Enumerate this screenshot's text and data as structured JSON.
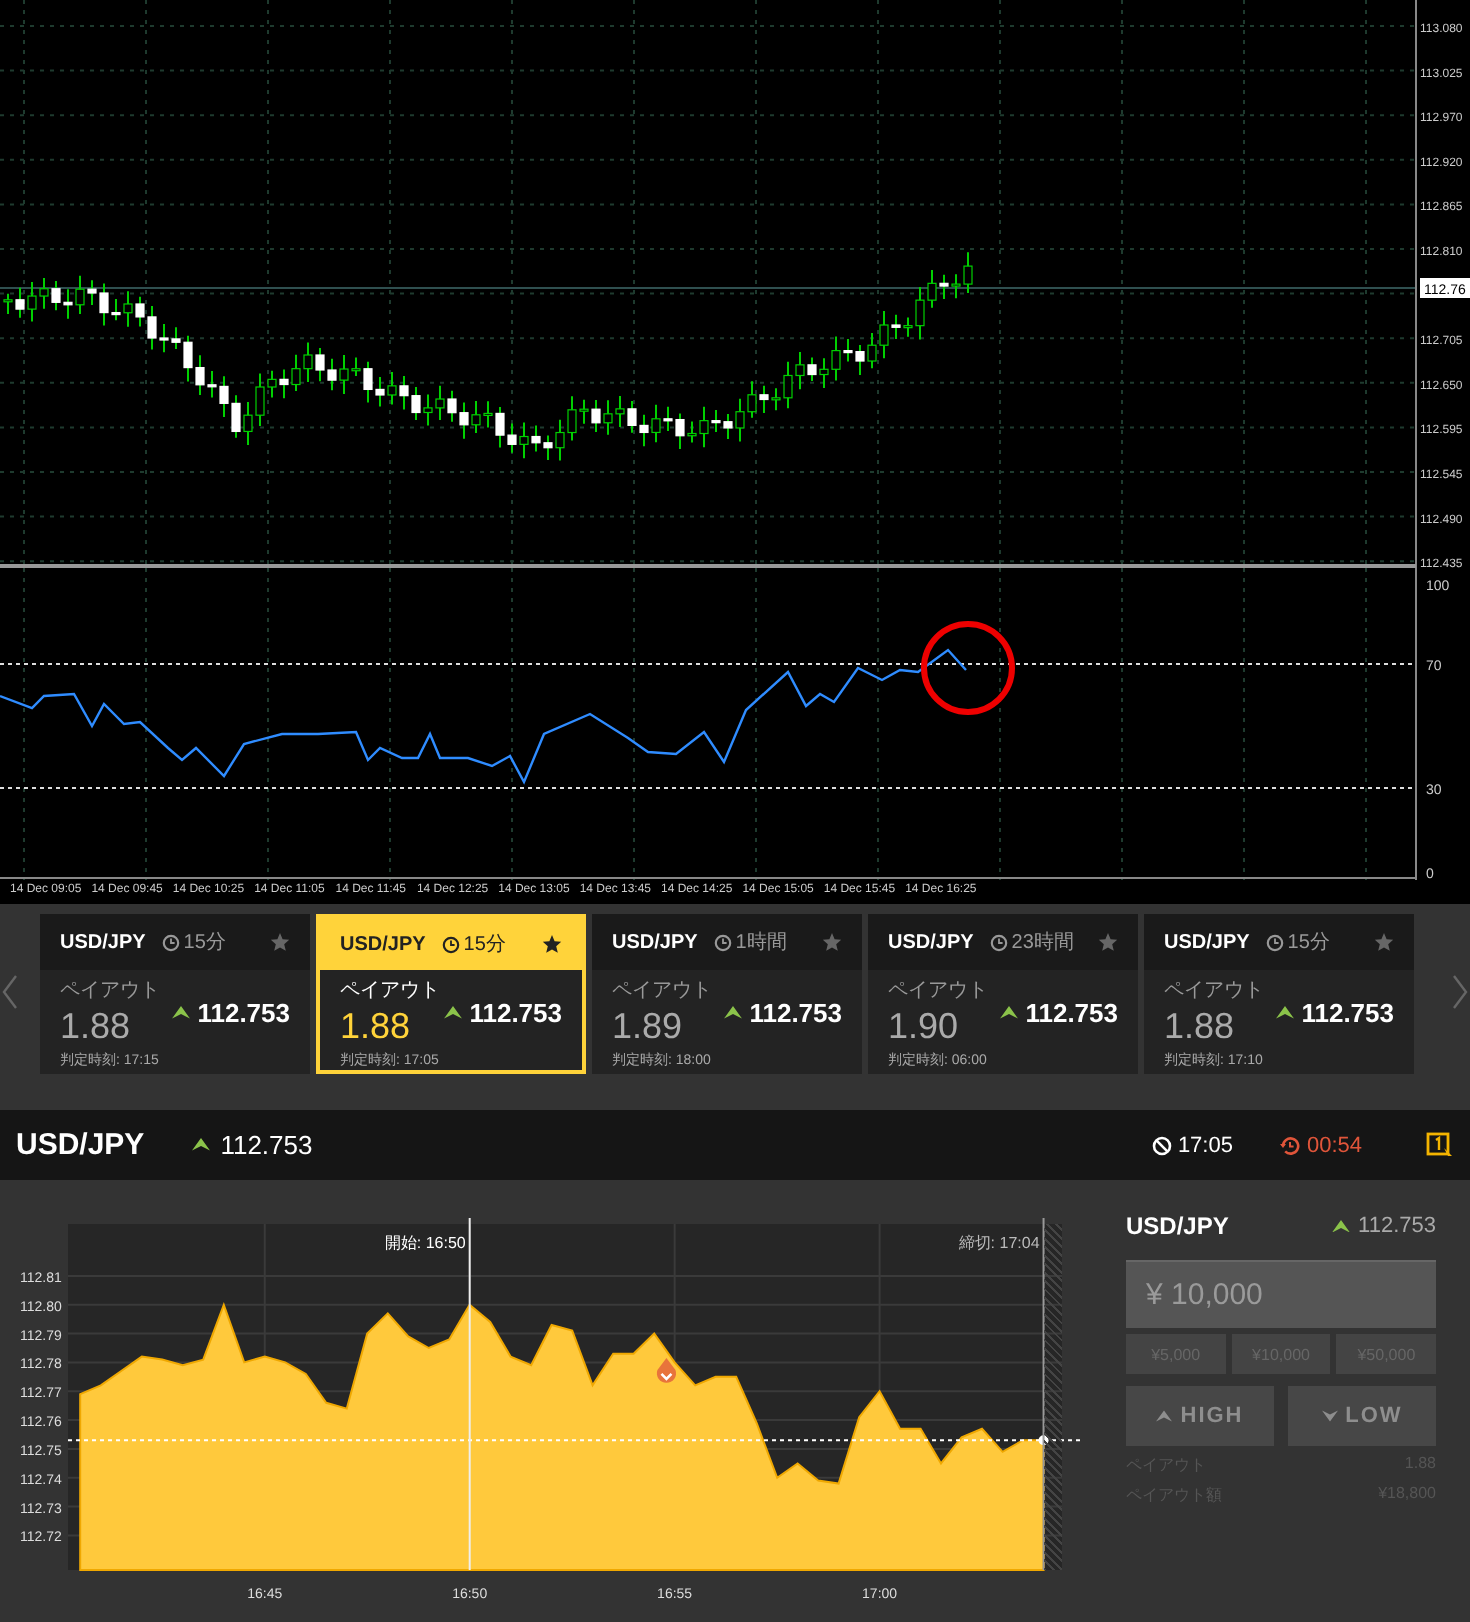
{
  "price_chart": {
    "price_axis": [
      "113.080",
      "113.025",
      "112.970",
      "112.920",
      "112.865",
      "112.810",
      "112.705",
      "112.650",
      "112.595",
      "112.545",
      "112.490",
      "112.435"
    ],
    "current_price": "112.76",
    "indicator_axis": [
      "100",
      "70",
      "30",
      "0"
    ],
    "time_axis": [
      "14 Dec 09:05",
      "14 Dec 09:45",
      "14 Dec 10:25",
      "14 Dec 11:05",
      "14 Dec 11:45",
      "14 Dec 12:25",
      "14 Dec 13:05",
      "14 Dec 13:45",
      "14 Dec 14:25",
      "14 Dec 15:05",
      "14 Dec 15:45",
      "14 Dec 16:25"
    ]
  },
  "cards": [
    {
      "pair": "USD/JPY",
      "duration": "15分",
      "payout_label": "ペイアウト",
      "payout": "1.88",
      "price": "112.753",
      "expiry": "判定時刻: 17:15",
      "selected": false
    },
    {
      "pair": "USD/JPY",
      "duration": "15分",
      "payout_label": "ペイアウト",
      "payout": "1.88",
      "price": "112.753",
      "expiry": "判定時刻: 17:05",
      "selected": true
    },
    {
      "pair": "USD/JPY",
      "duration": "1時間",
      "payout_label": "ペイアウト",
      "payout": "1.89",
      "price": "112.753",
      "expiry": "判定時刻: 18:00",
      "selected": false
    },
    {
      "pair": "USD/JPY",
      "duration": "23時間",
      "payout_label": "ペイアウト",
      "payout": "1.90",
      "price": "112.753",
      "expiry": "判定時刻: 06:00",
      "selected": false
    },
    {
      "pair": "USD/JPY",
      "duration": "15分",
      "payout_label": "ペイアウト",
      "payout": "1.88",
      "price": "112.753",
      "expiry": "判定時刻: 17:10",
      "selected": false
    }
  ],
  "header": {
    "pair": "USD/JPY",
    "price": "112.753",
    "close_time": "17:05",
    "countdown": "00:54"
  },
  "live_chart": {
    "chart_data": {
      "type": "area",
      "categories": [
        null,
        null,
        null,
        null,
        null,
        null,
        null,
        null,
        null,
        "16:45",
        null,
        null,
        null,
        null,
        null,
        null,
        null,
        null,
        null,
        "16:50",
        null,
        null,
        null,
        null,
        null,
        null,
        null,
        null,
        null,
        "16:55",
        null,
        null,
        null,
        null,
        null,
        null,
        null,
        null,
        null,
        "17:00",
        null,
        null,
        null,
        null,
        null,
        null,
        null,
        null
      ],
      "series": [
        {
          "color": "#ffc93c",
          "values": [
            112.769,
            112.772,
            112.777,
            112.782,
            112.781,
            112.779,
            112.781,
            112.8,
            112.78,
            112.782,
            112.78,
            112.776,
            112.766,
            112.764,
            112.79,
            112.797,
            112.789,
            112.785,
            112.788,
            112.8,
            112.794,
            112.782,
            112.779,
            112.793,
            112.791,
            112.772,
            112.783,
            112.783,
            112.79,
            112.78,
            112.772,
            112.775,
            112.775,
            112.759,
            112.74,
            112.745,
            112.739,
            112.738,
            112.761,
            112.77,
            112.757,
            112.757,
            112.745,
            112.754,
            112.757,
            112.749,
            112.753,
            112.753
          ]
        }
      ],
      "ylim": [
        112.708,
        112.828
      ],
      "grid": true,
      "ref_lines": [
        {
          "axis": "y",
          "value": 112.753
        }
      ],
      "yticks": [
        {
          "value": 112.72,
          "label": "112.72"
        },
        {
          "value": 112.73,
          "label": "112.73"
        },
        {
          "value": 112.74,
          "label": "112.74"
        },
        {
          "value": 112.75,
          "label": "112.75"
        },
        {
          "value": 112.76,
          "label": "112.76"
        },
        {
          "value": 112.77,
          "label": "112.77"
        },
        {
          "value": 112.78,
          "label": "112.78"
        },
        {
          "value": 112.79,
          "label": "112.79"
        },
        {
          "value": 112.8,
          "label": "112.80"
        },
        {
          "value": 112.81,
          "label": "112.81"
        }
      ],
      "annotations": [
        "開始: 16:50",
        "締切: 17:04"
      ]
    }
  },
  "trade_panel": {
    "pair": "USD/JPY",
    "price": "112.753",
    "amount_placeholder": "¥ 10,000",
    "quick_amounts": [
      "¥5,000",
      "¥10,000",
      "¥50,000"
    ],
    "buttons": [
      {
        "kind": "high",
        "label": "HIGH",
        "disabled": true
      },
      {
        "kind": "low",
        "label": "LOW",
        "disabled": true
      }
    ],
    "summary": [
      {
        "label": "ペイアウト",
        "value": "1.88"
      },
      {
        "label": "ペイアウト額",
        "value": "¥18,800"
      }
    ]
  }
}
